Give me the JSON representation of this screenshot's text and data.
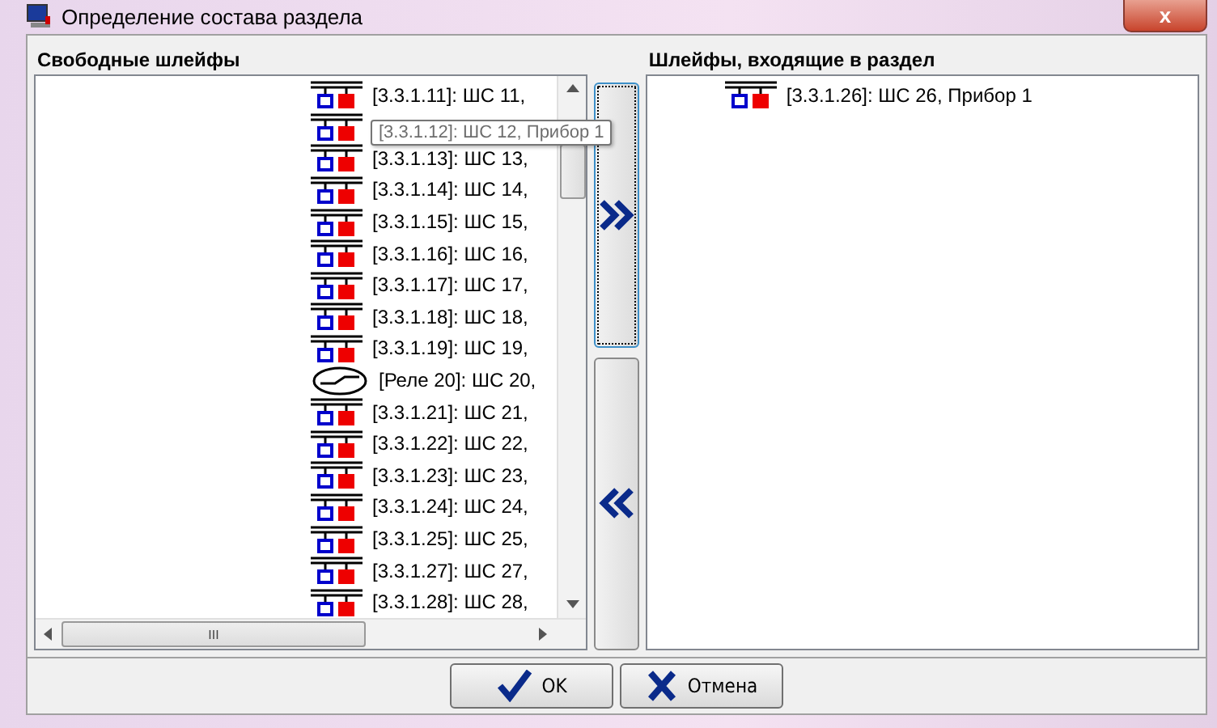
{
  "window": {
    "title": "Определение состава раздела",
    "close_label": "x"
  },
  "free_panel": {
    "heading": "Свободные шлейфы",
    "items": [
      {
        "kind": "loop",
        "label": "[3.3.1.11]: ШС 11,"
      },
      {
        "kind": "loop"
      },
      {
        "kind": "loop",
        "label": "[3.3.1.13]: ШС 13,"
      },
      {
        "kind": "loop",
        "label": "[3.3.1.14]: ШС 14,"
      },
      {
        "kind": "loop",
        "label": "[3.3.1.15]: ШС 15,"
      },
      {
        "kind": "loop",
        "label": "[3.3.1.16]: ШС 16,"
      },
      {
        "kind": "loop",
        "label": "[3.3.1.17]: ШС 17,"
      },
      {
        "kind": "loop",
        "label": "[3.3.1.18]: ШС 18,"
      },
      {
        "kind": "loop",
        "label": "[3.3.1.19]: ШС 19,"
      },
      {
        "kind": "relay",
        "label": "[Реле 20]: ШС 20,"
      },
      {
        "kind": "loop",
        "label": "[3.3.1.21]: ШС 21,"
      },
      {
        "kind": "loop",
        "label": "[3.3.1.22]: ШС 22,"
      },
      {
        "kind": "loop",
        "label": "[3.3.1.23]: ШС 23,"
      },
      {
        "kind": "loop",
        "label": "[3.3.1.24]: ШС 24,"
      },
      {
        "kind": "loop",
        "label": "[3.3.1.25]: ШС 25,"
      },
      {
        "kind": "loop",
        "label": "[3.3.1.27]: ШС 27,"
      },
      {
        "kind": "loop",
        "label": "[3.3.1.28]: ШС 28,"
      }
    ],
    "tooltip": "[3.3.1.12]: ШС 12, Прибор 1",
    "scroll_mark": "III"
  },
  "move_buttons": [
    {
      "kind": "add",
      "focused": true
    },
    {
      "kind": "remove",
      "focused": false
    }
  ],
  "section_panel": {
    "heading": "Шлейфы, входящие в раздел",
    "items": [
      {
        "kind": "loop",
        "label": "[3.3.1.26]: ШС 26, Прибор 1"
      }
    ]
  },
  "buttons": [
    {
      "kind": "ok",
      "label": "OK"
    },
    {
      "kind": "cancel",
      "label": "Отмена"
    }
  ]
}
